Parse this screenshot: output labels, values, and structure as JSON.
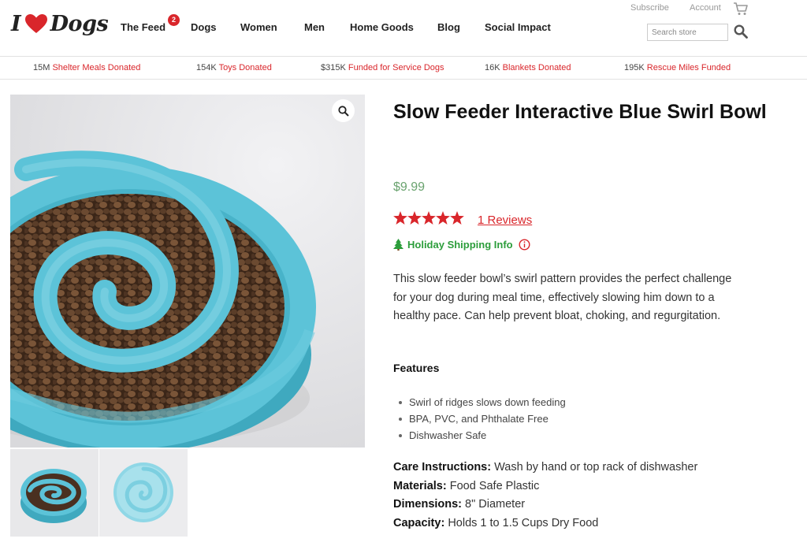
{
  "brand": {
    "logo_i": "I",
    "logo_dogs": "Dogs"
  },
  "nav": [
    {
      "label": "The Feed",
      "badge": "2"
    },
    {
      "label": "Dogs"
    },
    {
      "label": "Women"
    },
    {
      "label": "Men"
    },
    {
      "label": "Home Goods"
    },
    {
      "label": "Blog"
    },
    {
      "label": "Social Impact"
    }
  ],
  "util": {
    "subscribe": "Subscribe",
    "account": "Account"
  },
  "search": {
    "placeholder": "Search store"
  },
  "stats": [
    {
      "num": "15M",
      "label": "Shelter Meals Donated"
    },
    {
      "num": "154K",
      "label": "Toys Donated"
    },
    {
      "num": "$315K",
      "label": "Funded for Service Dogs"
    },
    {
      "num": "16K",
      "label": "Blankets Donated"
    },
    {
      "num": "195K",
      "label": "Rescue Miles Funded"
    }
  ],
  "product": {
    "title": "Slow Feeder Interactive Blue Swirl Bowl",
    "price": "$9.99",
    "rating": 5,
    "reviews": "1 Reviews",
    "holiday": "Holiday Shipping Info",
    "description": "This slow feeder bowl’s swirl pattern provides the perfect challenge for your dog during meal time, effectively slowing him down to a healthy pace. Can help prevent bloat, choking, and regurgitation.",
    "features_heading": "Features",
    "features": [
      "Swirl of ridges slows down feeding",
      "BPA, PVC, and Phthalate Free",
      "Dishwasher Safe"
    ],
    "specs": [
      {
        "label": "Care Instructions:",
        "value": "Wash by hand or top rack of dishwasher"
      },
      {
        "label": "Materials:",
        "value": "Food Safe Plastic"
      },
      {
        "label": "Dimensions:",
        "value": "8\" Diameter"
      },
      {
        "label": "Capacity:",
        "value": "Holds 1 to 1.5 Cups Dry Food"
      }
    ]
  },
  "colors": {
    "accent": "#d9262b",
    "price": "#6aa36f",
    "holiday": "#2c9d3b",
    "bowl": "#5cc3d8"
  }
}
